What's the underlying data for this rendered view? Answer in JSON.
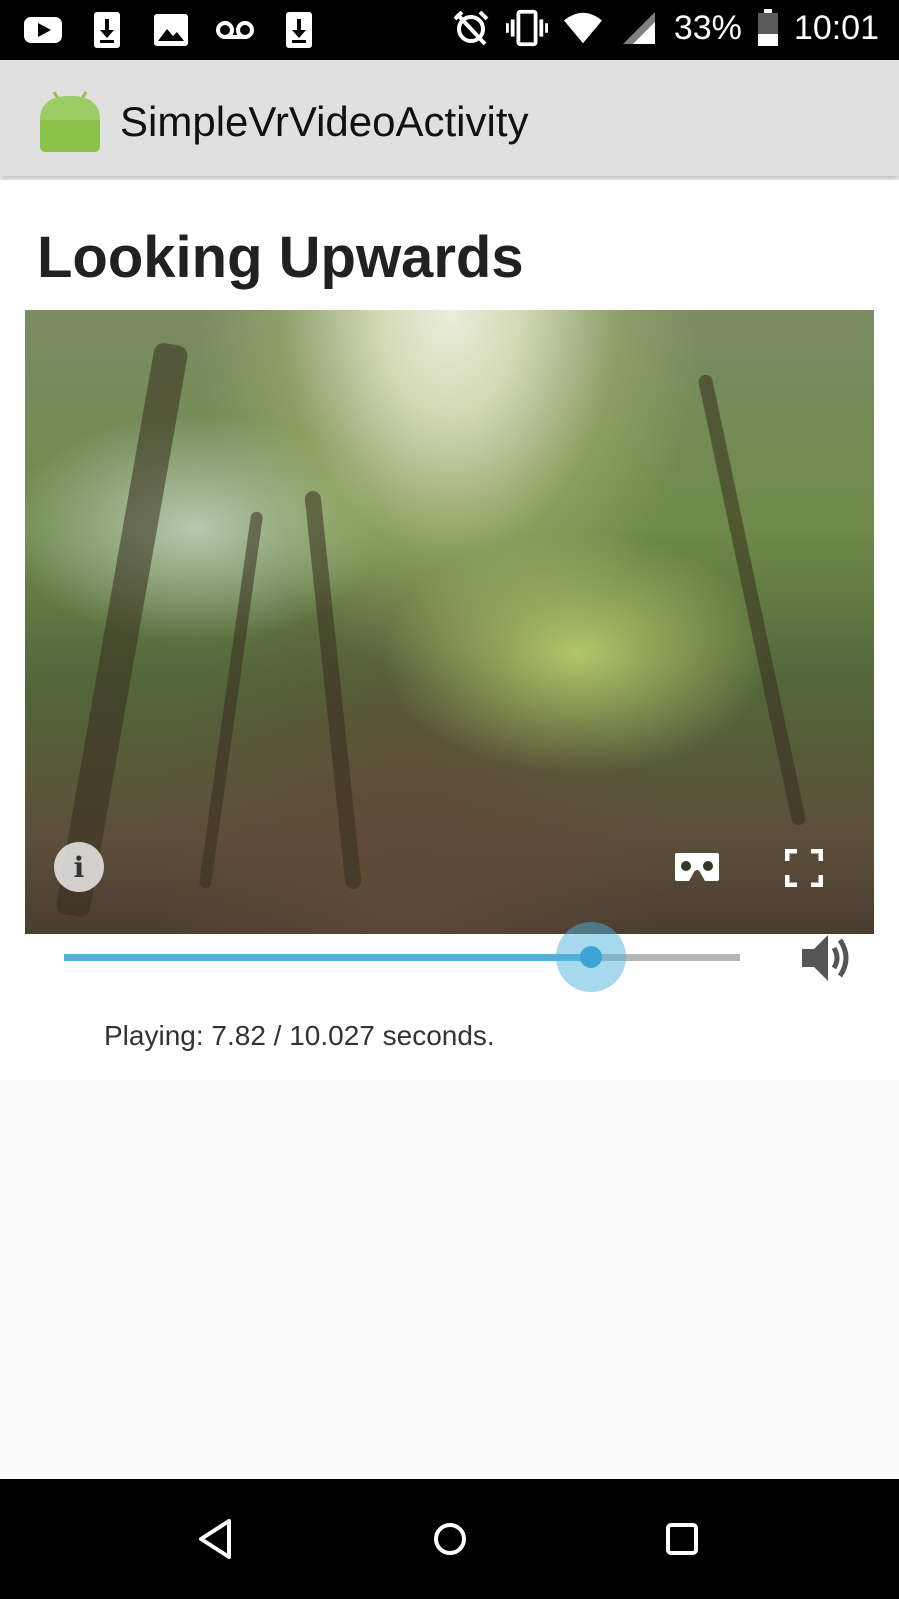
{
  "status_bar": {
    "left_icons": [
      "youtube-icon",
      "download-icon",
      "image-icon",
      "voicemail-icon",
      "download-icon"
    ],
    "battery_percent": "33%",
    "time": "10:01",
    "right_icons": [
      "alarm-off-icon",
      "vibrate-icon",
      "wifi-icon",
      "signal-icon",
      "battery-icon"
    ]
  },
  "app_bar": {
    "title": "SimpleVrVideoActivity",
    "logo_icon": "android-icon"
  },
  "content": {
    "title": "Looking Upwards",
    "video": {
      "info_label": "i",
      "controls": [
        "info-icon",
        "cardboard-icon",
        "fullscreen-icon"
      ]
    },
    "seekbar": {
      "progress": 0.7799
    },
    "status": "Playing: 7.82 / 10.027 seconds."
  },
  "nav_bar": {
    "buttons": [
      "back-icon",
      "home-icon",
      "recents-icon"
    ]
  },
  "colors": {
    "accent": "#4fb1dc",
    "app_bar": "#e0e0e0",
    "android_green": "#8bc34a"
  }
}
